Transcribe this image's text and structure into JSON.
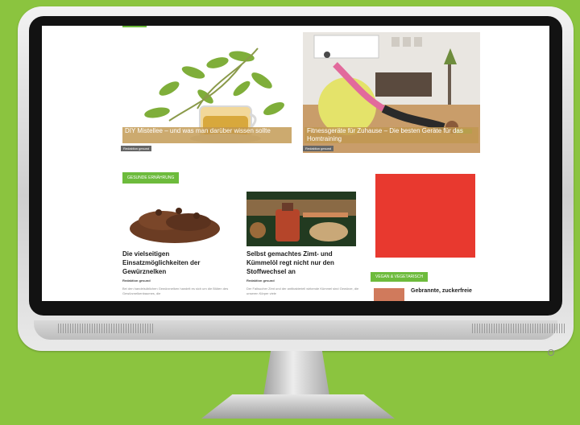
{
  "colors": {
    "background": "#8bc43f",
    "accent": "#6dbb3c",
    "ad": "#e8392f",
    "caption": "#c1974f"
  },
  "hero1": {
    "caption": "DIY Mistellee – und was man darüber wissen sollte",
    "tag": "Redaktion gesund"
  },
  "hero2": {
    "caption": "Fitnessgeräte für Zuhause – Die besten Geräte für das Homtraining",
    "tag": "Redaktion gesund"
  },
  "section1": {
    "label": "GESUNDE ERNÄHRUNG"
  },
  "card1": {
    "title": "Die vielseitigen Einsatzmöglichkeiten der Gewürznelken",
    "author": "Redaktion gesund",
    "excerpt": "Bei den handelsüblichen Gewürznelken handelt es sich um die Blüten des Gewürznelkenbaumes, die"
  },
  "card2": {
    "title": "Selbst gemachtes Zimt- und Kümmelöl regt nicht nur den Stoffwechsel an",
    "author": "Redaktion gesund",
    "excerpt": "Der Fallsucher Zimt und der antibakteriell wirkende Kümmel sind Gewürze, die unseren Körper viele"
  },
  "section2": {
    "label": "VEGAN & VEGETARISCH"
  },
  "sidebar": {
    "title": "Gebrannte, zuckerfreie"
  }
}
